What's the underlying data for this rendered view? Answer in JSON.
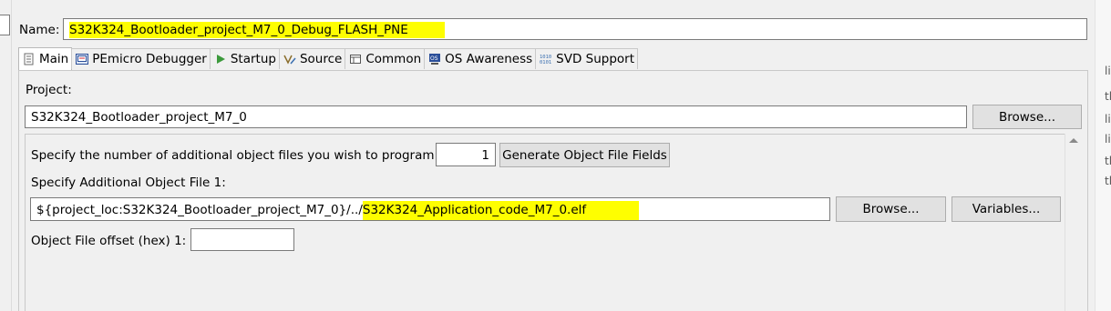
{
  "name": {
    "label": "Name:",
    "value": "S32K324_Bootloader_project_M7_0_Debug_FLASH_PNE"
  },
  "tabs": [
    {
      "label": "Main",
      "icon": "document-icon"
    },
    {
      "label": "PEmicro Debugger",
      "icon": "pemicro-icon"
    },
    {
      "label": "Startup",
      "icon": "play-icon"
    },
    {
      "label": "Source",
      "icon": "source-icon"
    },
    {
      "label": "Common",
      "icon": "window-icon"
    },
    {
      "label": "OS Awareness",
      "icon": "os-icon"
    },
    {
      "label": "SVD Support",
      "icon": "binary-icon"
    }
  ],
  "project": {
    "label": "Project:",
    "value": "S32K324_Bootloader_project_M7_0",
    "browse": "Browse..."
  },
  "objects": {
    "count_label": "Specify the number of additional object files you wish to program:",
    "count_value": "1",
    "generate": "Generate Object File Fields",
    "file_label": "Specify Additional Object File 1:",
    "file_prefix": "${project_loc:S32K324_Bootloader_project_M7_0}/../",
    "file_name": "S32K324_Application_code_M7_0.elf",
    "browse": "Browse...",
    "variables": "Variables...",
    "offset_label": "Object File offset (hex) 1:",
    "offset_value": ""
  },
  "right_fragments": [
    "li",
    "tl",
    "li",
    "li",
    "tl",
    "tl"
  ],
  "colors": {
    "highlight": "#fefe00",
    "tab_active": "#ffffff",
    "button": "#e1e1e1"
  }
}
